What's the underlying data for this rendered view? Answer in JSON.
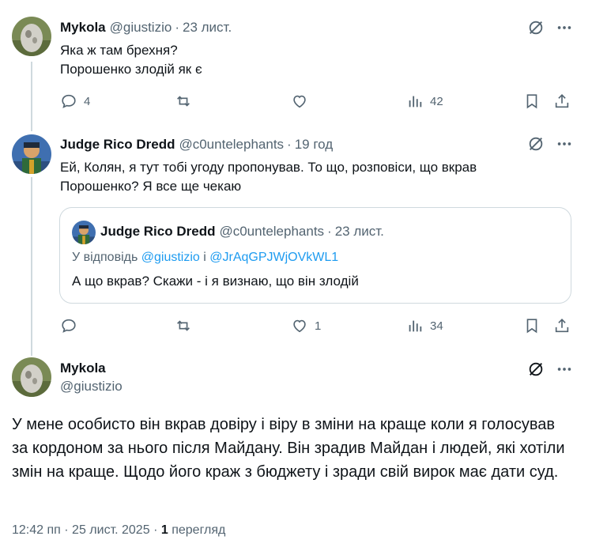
{
  "tweets": [
    {
      "name": "Mykola",
      "handle": "@giustizio",
      "dot": "·",
      "time": "23 лист.",
      "lines": [
        "Яка ж там брехня?",
        "Порошенко злодій як є"
      ],
      "replies": "4",
      "reposts": "",
      "likes": "",
      "views": "42"
    },
    {
      "name": "Judge Rico Dredd",
      "handle": "@c0untelephants",
      "dot": "·",
      "time": "19 год",
      "lines": [
        "Ей, Колян, я тут тобі угоду пропонував. То що, розповіси, що вкрав",
        "Порошенко? Я все ще чекаю"
      ],
      "replies": "",
      "reposts": "",
      "likes": "1",
      "views": "34",
      "quote": {
        "name": "Judge Rico Dredd",
        "handle": "@c0untelephants",
        "dot": "·",
        "time": "23 лист.",
        "reply_prefix": "У відповідь",
        "reply_user1": "@giustizio",
        "reply_and": "і",
        "reply_user2": "@JrAqGPJWjOVkWL1",
        "text": "А що вкрав? Скажи - і я визнаю, що він злодій"
      }
    }
  ],
  "main": {
    "name": "Mykola",
    "handle": "@giustizio",
    "text": "У мене особисто він вкрав довіру і віру в зміни на краще коли я голосував за кордоном за нього після Майдану. Він зрадив Майдан і людей, які хотіли змін на краще. Щодо його краж з бюджету і зради свій вирок має дати суд.",
    "time": "12:42 пп",
    "date": "25 лист. 2025",
    "dot": "·",
    "views_count": "1",
    "views_label": "перегляд"
  },
  "icons": {
    "grok": "grok-icon",
    "more": "more-icon",
    "reply": "reply-icon",
    "repost": "repost-icon",
    "like": "like-icon",
    "views": "views-icon",
    "bookmark": "bookmark-icon",
    "share": "share-icon"
  },
  "colors": {
    "text": "#0f1419",
    "secondary": "#536471",
    "link": "#1d9bf0",
    "border": "#cfd9de"
  }
}
